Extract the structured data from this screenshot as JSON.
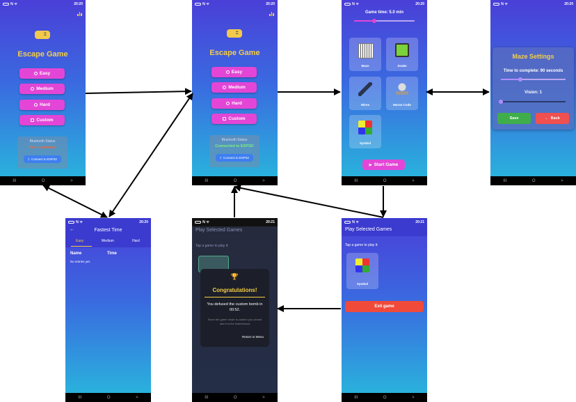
{
  "status": {
    "time_a": "20:20",
    "time_b": "20:21",
    "nav": [
      "III",
      "O",
      ">"
    ]
  },
  "home": {
    "title": "Escape Game",
    "buttons": [
      "Easy",
      "Medium",
      "Hard",
      "Custom"
    ],
    "bluetooth_header": "Bluetooth Status",
    "status_disconnected": "Not connected",
    "status_connected": "Connected to ESP32!",
    "connect_label": "Connect to ESP32"
  },
  "custom": {
    "game_time": "Game time: 5.0 min",
    "game_time_fraction": 0.33,
    "games": [
      "Maze",
      "Snake",
      "Wires",
      "Morse Code",
      "Symbol"
    ],
    "start_label": "Start Game"
  },
  "maze_settings": {
    "title": "Maze Settings",
    "time_label": "Time to complete: 90 seconds",
    "time_fraction": 0.3,
    "vision_label": "Vision: 1",
    "vision_fraction": 0.0,
    "save_label": "Save",
    "back_label": "Back"
  },
  "fastest": {
    "title": "Fastest Time",
    "tabs": [
      "Easy",
      "Medium",
      "Hard"
    ],
    "col_name": "Name",
    "col_time": "Time",
    "empty": "No entries yet."
  },
  "play": {
    "title": "Play Selected Games",
    "instruction": "Tap a game to play it:",
    "game": "Symbol",
    "exit_label": "Exit game"
  },
  "congrats": {
    "title": "Congratulations!",
    "message": "You defused the custom bomb in 00:52.",
    "note": "Since the game mode is custom you cannot add it to the leaderboard",
    "return_label": "Return to Menu"
  },
  "colors": {
    "accent_yellow": "#f4cf47",
    "menu_button": "#e346d6",
    "connect_button": "#3d7ff0",
    "save_green": "#3fae4a",
    "back_red": "#f05050",
    "exit_red": "#f04a3a",
    "connected_green": "#7df07a",
    "disconnected_red": "#f06a3a"
  },
  "icons": [
    "gamepad-icon",
    "leaderboard-icon",
    "bluetooth-icon",
    "trophy-icon",
    "back-arrow-icon",
    "play-icon"
  ]
}
